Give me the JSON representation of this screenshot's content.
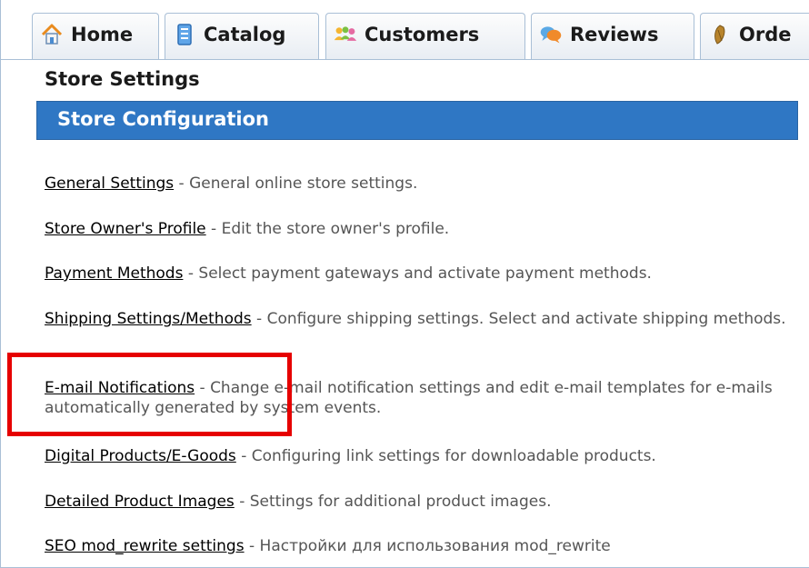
{
  "tabs": [
    {
      "label": "Home",
      "icon": "home-icon"
    },
    {
      "label": "Catalog",
      "icon": "catalog-icon"
    },
    {
      "label": "Customers",
      "icon": "customers-icon"
    },
    {
      "label": "Reviews",
      "icon": "reviews-icon"
    },
    {
      "label": "Orde",
      "icon": "orders-icon"
    }
  ],
  "page": {
    "section_title": "Store Settings",
    "config_title": "Store Configuration"
  },
  "items": [
    {
      "link": "General Settings",
      "description": "General online store settings."
    },
    {
      "link": "Store Owner's Profile",
      "description": "Edit the store owner's profile."
    },
    {
      "link": "Payment Methods",
      "description": "Select payment gateways and activate payment methods."
    },
    {
      "link": "Shipping Settings/Methods",
      "description": "Configure shipping settings. Select and activate shipping methods."
    },
    {
      "link": "E-mail Notifications",
      "description": "Change e-mail notification settings and edit e-mail templates for e-mails automatically generated by system events."
    },
    {
      "link": "Digital Products/E-Goods",
      "description": "Configuring link settings for downloadable products."
    },
    {
      "link": "Detailed Product Images",
      "description": "Settings for additional product images."
    },
    {
      "link": "SEO mod_rewrite settings",
      "description": "Настройки для использования mod_rewrite"
    }
  ],
  "separator": "-",
  "colors": {
    "config_bar": "#2f77c4",
    "highlight": "#e60000",
    "tab_border": "#a9bfd6"
  }
}
